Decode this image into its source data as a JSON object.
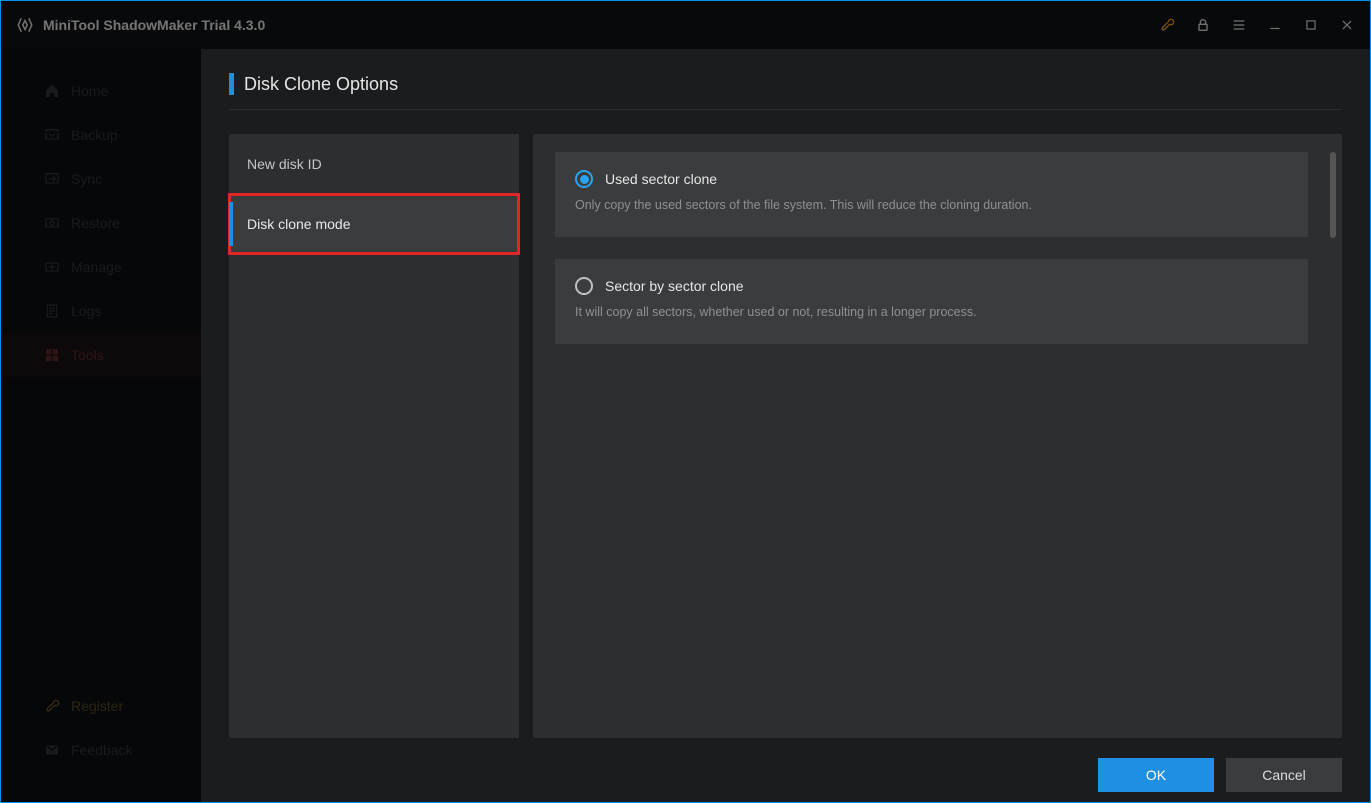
{
  "app": {
    "title": "MiniTool ShadowMaker Trial 4.3.0"
  },
  "sidebar": {
    "items": [
      {
        "label": "Home"
      },
      {
        "label": "Backup"
      },
      {
        "label": "Sync"
      },
      {
        "label": "Restore"
      },
      {
        "label": "Manage"
      },
      {
        "label": "Logs"
      },
      {
        "label": "Tools"
      }
    ],
    "bottom": [
      {
        "label": "Register"
      },
      {
        "label": "Feedback"
      }
    ]
  },
  "page": {
    "title": "Disk Clone Options"
  },
  "left_panel": {
    "items": [
      {
        "label": "New disk ID"
      },
      {
        "label": "Disk clone mode"
      }
    ]
  },
  "options": [
    {
      "label": "Used sector clone",
      "desc": "Only copy the used sectors of the file system. This will reduce the cloning duration.",
      "selected": true
    },
    {
      "label": "Sector by sector clone",
      "desc": "It will copy all sectors, whether used or not, resulting in a longer process.",
      "selected": false
    }
  ],
  "buttons": {
    "ok": "OK",
    "cancel": "Cancel"
  }
}
